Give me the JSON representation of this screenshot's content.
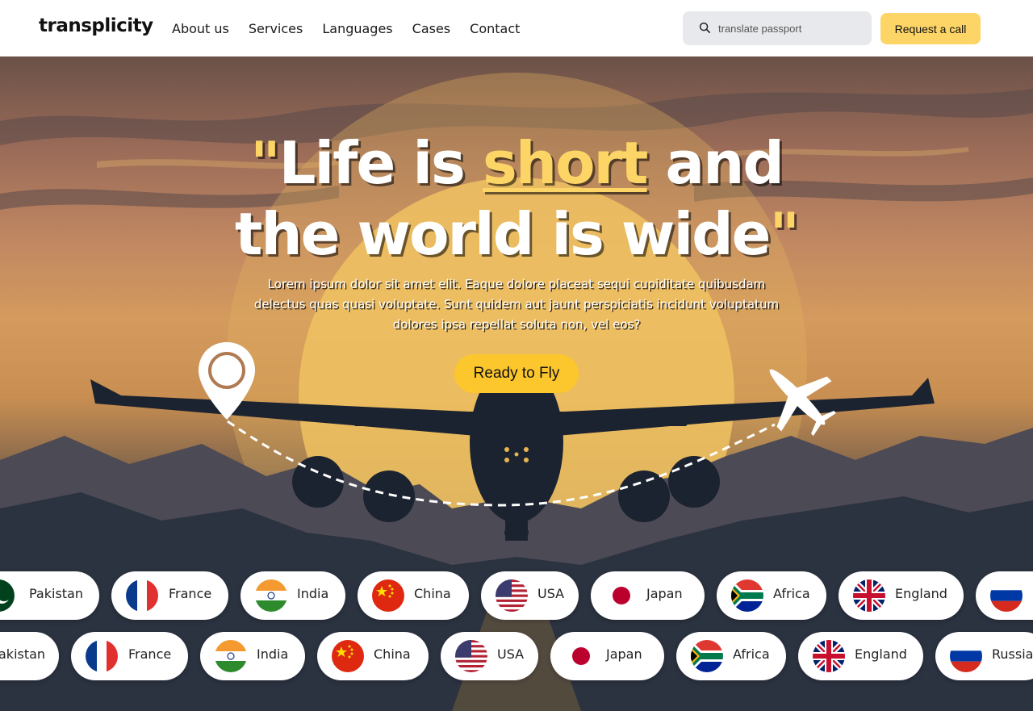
{
  "header": {
    "logo": "transplicity",
    "nav": [
      "About us",
      "Services",
      "Languages",
      "Cases",
      "Contact"
    ],
    "search_placeholder": "translate passport",
    "cta_label": "Request a call"
  },
  "hero": {
    "headline_open_quote": "\"",
    "headline_part1": "Life is ",
    "headline_highlight": "short",
    "headline_part2": " and",
    "headline_line2": "the world is wide",
    "headline_close_quote": "\"",
    "lead": "Lorem ipsum dolor sit amet elit. Eaque dolore placeat sequi cupiditate quibusdam delectus quas quasi voluptate. Sunt quidem aut jaunt perspiciatis incidunt voluptatum dolores ipsa repellat soluta non, vel eos?",
    "button_label": "Ready to Fly"
  },
  "countries": {
    "row1": [
      "Pakistan",
      "France",
      "India",
      "China",
      "USA",
      "Japan",
      "Africa",
      "England",
      ""
    ],
    "row2": [
      "akistan",
      "France",
      "India",
      "China",
      "USA",
      "Japan",
      "Africa",
      "England",
      "Russia"
    ]
  },
  "colors": {
    "accent": "#fdd466",
    "button": "#fcc62d",
    "search_bg": "#e8e9ec"
  }
}
